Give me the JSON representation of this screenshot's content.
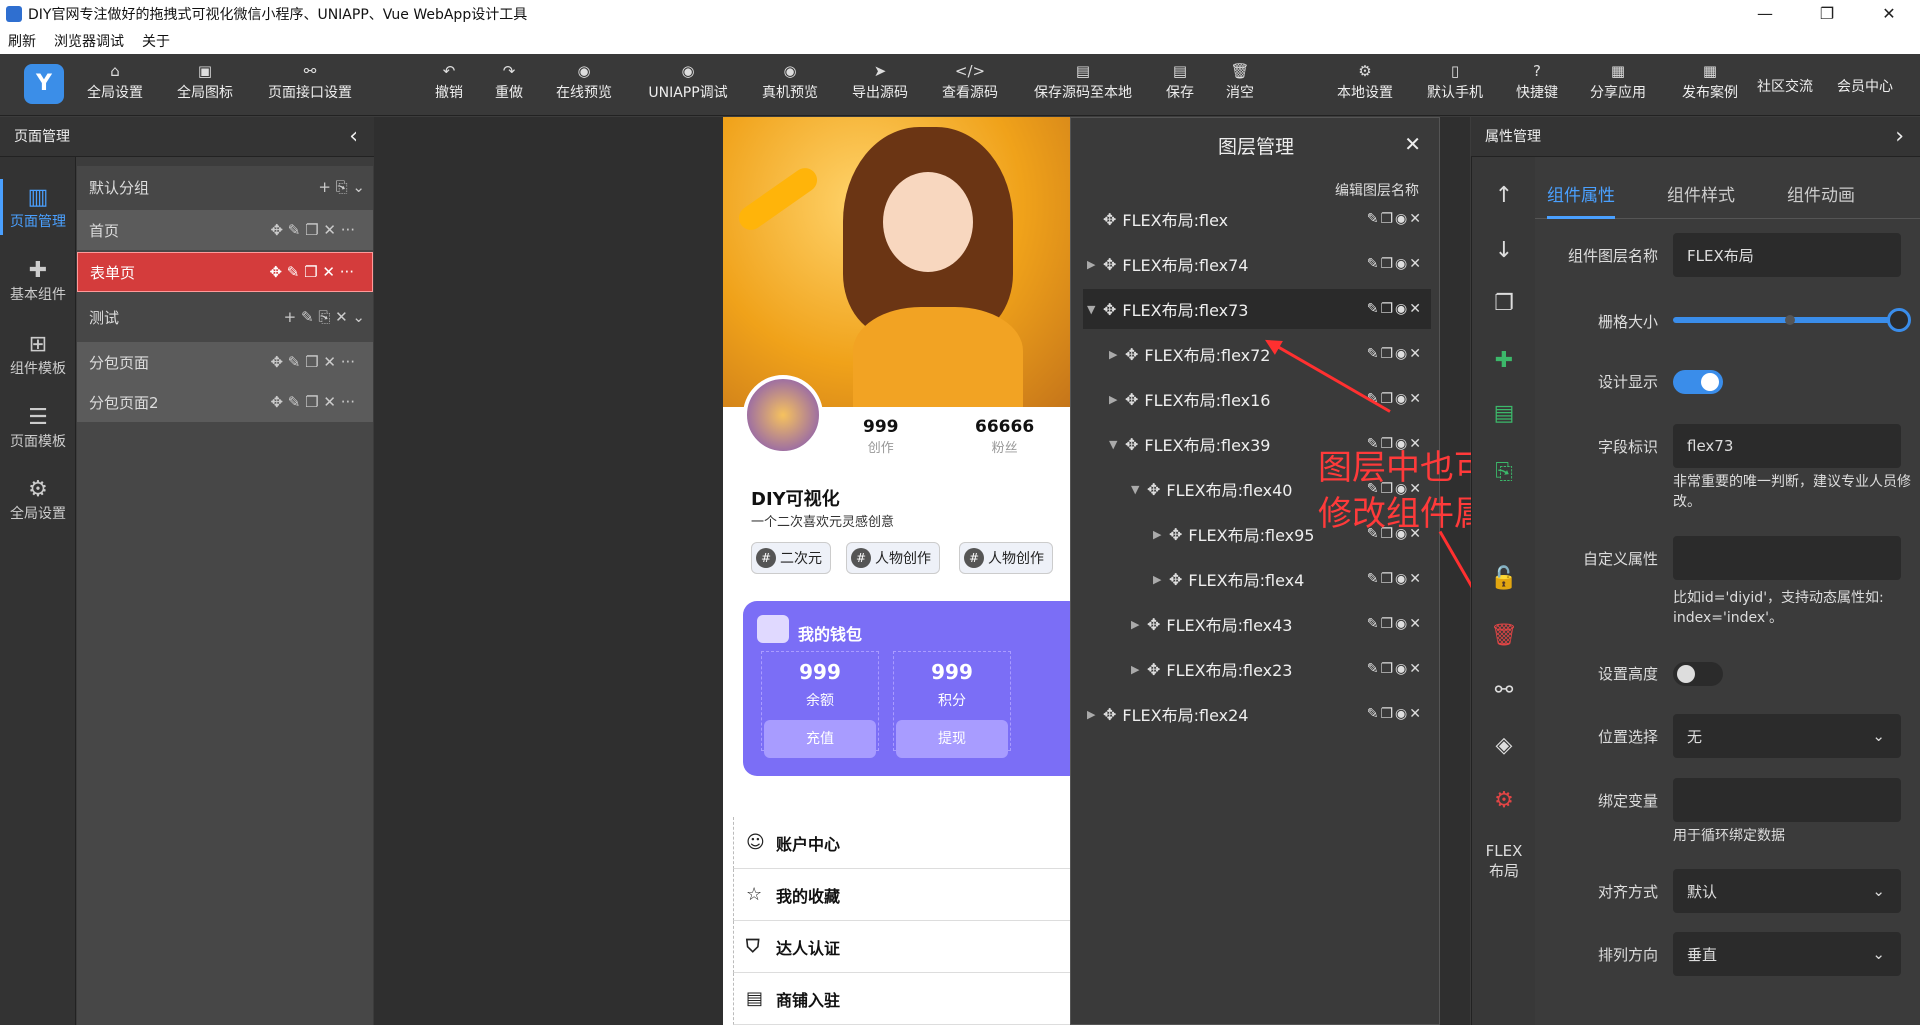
{
  "window": {
    "title": "DIY官网专注做好的拖拽式可视化微信小程序、UNIAPP、Vue WebApp设计工具",
    "minimize": "—",
    "restore": "❐",
    "close": "✕"
  },
  "menubar": [
    "刷新",
    "浏览器调试",
    "关于"
  ],
  "toolbar": {
    "logo": "Y",
    "items": [
      {
        "label": "全局设置",
        "icon": "⌂"
      },
      {
        "label": "全局图标",
        "icon": "▣"
      },
      {
        "label": "页面接口设置",
        "icon": "⚯"
      },
      {
        "label": "撤销",
        "icon": "↶"
      },
      {
        "label": "重做",
        "icon": "↷"
      },
      {
        "label": "在线预览",
        "icon": "◉"
      },
      {
        "label": "UNIAPP调试",
        "icon": "◉"
      },
      {
        "label": "真机预览",
        "icon": "◉"
      },
      {
        "label": "导出源码",
        "icon": "➤"
      },
      {
        "label": "查看源码",
        "icon": "</>"
      },
      {
        "label": "保存源码至本地",
        "icon": "▤"
      },
      {
        "label": "保存",
        "icon": "▤"
      },
      {
        "label": "消空",
        "icon": "🗑"
      },
      {
        "label": "本地设置",
        "icon": "⚙"
      },
      {
        "label": "默认手机",
        "icon": "▯"
      },
      {
        "label": "快捷键",
        "icon": "?"
      },
      {
        "label": "分享应用",
        "icon": "▦"
      },
      {
        "label": "发布案例",
        "icon": "▦"
      }
    ],
    "plain": [
      "社区交流",
      "会员中心"
    ]
  },
  "left_panel": {
    "title": "页面管理",
    "collapse": "‹"
  },
  "leftnav": [
    {
      "label": "页面管理",
      "icon": "▥",
      "active": true
    },
    {
      "label": "基本组件",
      "icon": "✚",
      "active": false
    },
    {
      "label": "组件模板",
      "icon": "⊞",
      "active": false
    },
    {
      "label": "页面模板",
      "icon": "☰",
      "active": false
    },
    {
      "label": "全局设置",
      "icon": "⚙",
      "active": false
    }
  ],
  "pages": {
    "group1": {
      "name": "默认分组",
      "acts": "+ ⎘ ⌄"
    },
    "group1_pages": [
      {
        "name": "首页",
        "selected": false
      },
      {
        "name": "表单页",
        "selected": true
      }
    ],
    "group2": {
      "name": "测试",
      "acts": "+ ✎ ⎘ ✕ ⌄"
    },
    "group2_pages": [
      {
        "name": "分包页面",
        "selected": false
      },
      {
        "name": "分包页面2",
        "selected": false
      }
    ],
    "row_acts": "✥ ✎ ❐ ✕ ···"
  },
  "phone": {
    "stats": [
      {
        "value": "999",
        "label": "创作"
      },
      {
        "value": "66666",
        "label": "粉丝"
      }
    ],
    "nickname": "DIY可视化",
    "desc": "一个二次喜欢元灵感创意",
    "tags": [
      "二次元",
      "人物创作",
      "人物创作"
    ],
    "tag_icon": "#",
    "wallet": {
      "title": "我的钱包",
      "cells": [
        {
          "value": "999",
          "label": "余额",
          "button": "充值"
        },
        {
          "value": "999",
          "label": "积分",
          "button": "提现"
        }
      ]
    },
    "menu": [
      {
        "label": "账户中心",
        "icon": "☺"
      },
      {
        "label": "我的收藏",
        "icon": "☆"
      },
      {
        "label": "达人认证",
        "icon": "⛉"
      },
      {
        "label": "商铺入驻",
        "icon": "▤"
      }
    ]
  },
  "layers": {
    "title": "图层管理",
    "close": "✕",
    "edit_names": "编辑图层名称",
    "row_acts": "✎❐◉✕",
    "rows": [
      {
        "label": "FLEX布局:flex",
        "arrow": "",
        "indent": 0,
        "selected": false
      },
      {
        "label": "FLEX布局:flex74",
        "arrow": "▶",
        "indent": 0,
        "selected": false
      },
      {
        "label": "FLEX布局:flex73",
        "arrow": "▼",
        "indent": 0,
        "selected": true
      },
      {
        "label": "FLEX布局:flex72",
        "arrow": "▶",
        "indent": 1,
        "selected": false
      },
      {
        "label": "FLEX布局:flex16",
        "arrow": "▶",
        "indent": 1,
        "selected": false
      },
      {
        "label": "FLEX布局:flex39",
        "arrow": "▼",
        "indent": 1,
        "selected": false
      },
      {
        "label": "FLEX布局:flex40",
        "arrow": "▼",
        "indent": 2,
        "selected": false
      },
      {
        "label": "FLEX布局:flex95",
        "arrow": "▶",
        "indent": 3,
        "selected": false
      },
      {
        "label": "FLEX布局:flex4",
        "arrow": "▶",
        "indent": 3,
        "selected": false
      },
      {
        "label": "FLEX布局:flex43",
        "arrow": "▶",
        "indent": 2,
        "selected": false
      },
      {
        "label": "FLEX布局:flex23",
        "arrow": "▶",
        "indent": 2,
        "selected": false
      },
      {
        "label": "FLEX布局:flex24",
        "arrow": "▶",
        "indent": 0,
        "selected": false
      }
    ]
  },
  "annotation": {
    "line1": "图层中也可以快速定位组件",
    "line2": "修改组件属性来修改组件"
  },
  "sidetools": {
    "icons": [
      "↑",
      "↓",
      "❐",
      "✚",
      "▤",
      "⎘",
      "🔓",
      "🗑",
      "⚯",
      "◈",
      "⚙"
    ],
    "label": "FLEX\n布局"
  },
  "props": {
    "title": "属性管理",
    "collapse": "›",
    "tabs": [
      "组件属性",
      "组件样式",
      "组件动画"
    ],
    "layer_name_label": "组件图层名称",
    "layer_name_value": "FLEX布局",
    "grid_label": "栅格大小",
    "grid_value": 1.0,
    "design_label": "设计显示",
    "design_on": true,
    "field_label": "字段标识",
    "field_value": "flex73",
    "field_hint": "非常重要的唯一判断，建议专业人员修改。",
    "custom_label": "自定义属性",
    "custom_hint": "比如id='diyid'，支持动态属性如: index='index'。",
    "height_label": "设置高度",
    "height_on": false,
    "pos_label": "位置选择",
    "pos_value": "无",
    "bind_label": "绑定变量",
    "bind_hint": "用于循环绑定数据",
    "align_label": "对齐方式",
    "align_value": "默认",
    "dir_label": "排列方向",
    "dir_value": "垂直",
    "dd": "⌄"
  }
}
